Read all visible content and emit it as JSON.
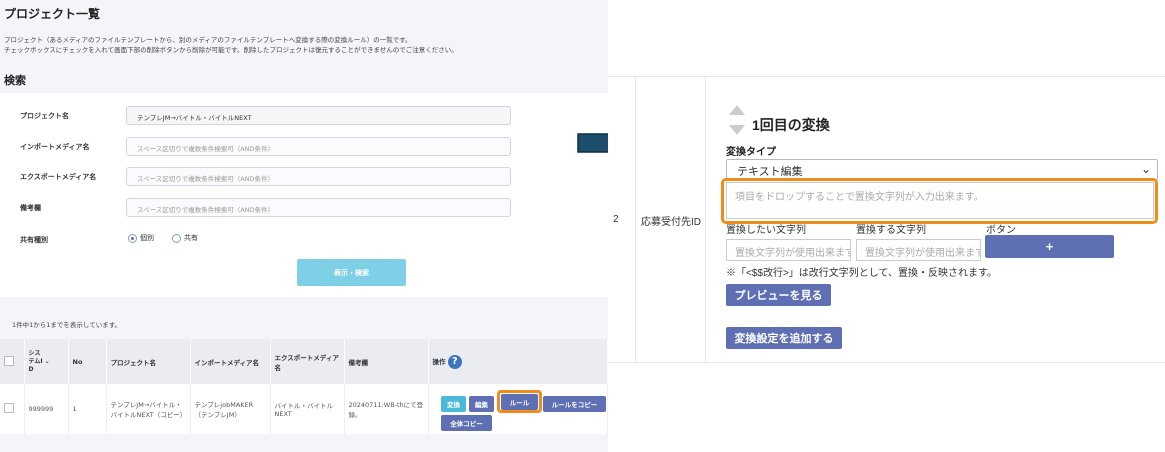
{
  "left": {
    "title": "プロジェクト一覧",
    "desc1": "プロジェクト（あるメディアのファイルテンプレートから、別のメディアのファイルテンプレートへ変換する際の変換ルール）の一覧です。",
    "desc2": "チェックボックスにチェックを入れて画面下部の削除ボタンから削除が可能です。削除したプロジェクトは復元することができませんのでご注意ください。",
    "search_heading": "検索",
    "fields": [
      {
        "label": "プロジェクト名",
        "value": "テンプレJM→バイトル・バイトルNEXT"
      },
      {
        "label": "インポートメディア名",
        "placeholder": "スペース区切りで複数条件検索可（AND条件）"
      },
      {
        "label": "エクスポートメディア名",
        "placeholder": "スペース区切りで複数条件検索可（AND条件）"
      },
      {
        "label": "備考欄",
        "placeholder": "スペース区切りで複数条件検索可（AND条件）"
      }
    ],
    "share_label": "共有種別",
    "share_options": [
      "個別",
      "共有"
    ],
    "share_selected": "個別",
    "search_button": "表示・検索",
    "result_count": "1件中1から1までを表示しています。",
    "table": {
      "headers": [
        "システムID",
        "No",
        "プロジェクト名",
        "インポートメディア名",
        "エクスポートメディア名",
        "備考欄",
        "操作"
      ],
      "header_sys_lines": [
        "シス",
        "テムI",
        "D"
      ],
      "row": {
        "id": "999999",
        "no": "1",
        "project": "テンプレJM→バイトル・バイトルNEXT（コピー）",
        "import": "テンプレjobMAKER（テンプレJM）",
        "export": "バイトル・バイトルNEXT",
        "note": "20240711:WB-thにて登録。"
      },
      "ops": [
        "変換",
        "編集",
        "ルール",
        "ルールをコピー",
        "全体コピー"
      ]
    }
  },
  "right": {
    "row_number": "2",
    "field_name": "応募受付先ID",
    "conversion_title": "1回目の変換",
    "type_label": "変換タイプ",
    "type_value": "テキスト編集",
    "textarea_placeholder": "項目をドロップすることで置換文字列が入力出来ます。",
    "col_labels": [
      "置換したい文字列",
      "置換する文字列",
      "ボタン"
    ],
    "input_placeholder": "置換文字列が使用出来ます",
    "plus_label": "+",
    "note": "※「<$$改行>」は改行文字列として、置換・反映されます。",
    "preview_button": "プレビューを見る",
    "add_button": "変換設定を追加する"
  },
  "colors": {
    "accent": "#5e6fb3",
    "highlight": "#f08c1a",
    "search_btn": "#7ed0e6",
    "arrow": "#1e4e6e"
  }
}
